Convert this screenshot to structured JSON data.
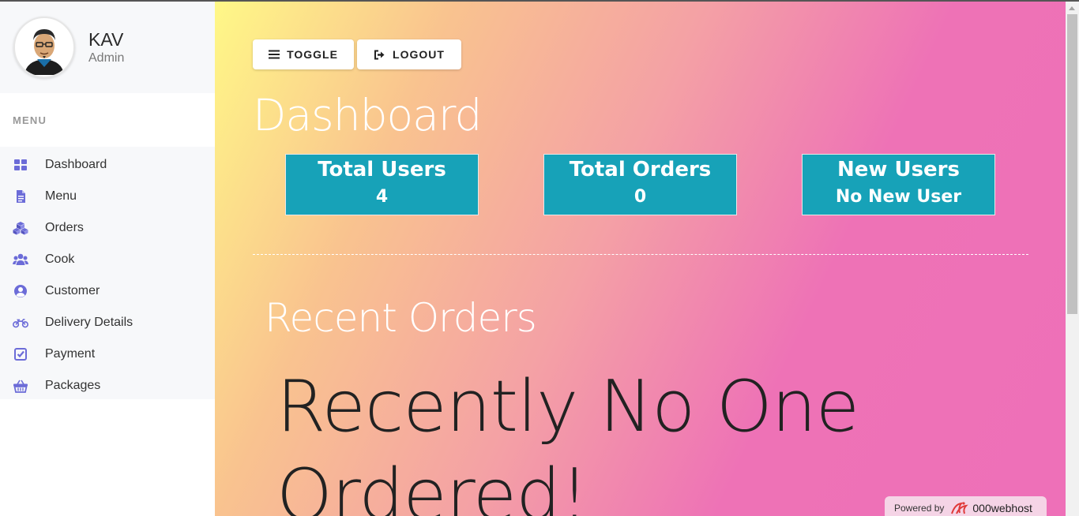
{
  "user": {
    "name": "KAV",
    "role": "Admin"
  },
  "menu": {
    "heading": "MENU",
    "items": [
      {
        "label": "Dashboard",
        "icon": "dashboard-icon"
      },
      {
        "label": "Menu",
        "icon": "document-icon"
      },
      {
        "label": "Orders",
        "icon": "cubes-icon"
      },
      {
        "label": "Cook",
        "icon": "users-icon"
      },
      {
        "label": "Customer",
        "icon": "user-circle-icon"
      },
      {
        "label": "Delivery Details",
        "icon": "motorcycle-icon"
      },
      {
        "label": "Payment",
        "icon": "check-square-icon"
      },
      {
        "label": "Packages",
        "icon": "basket-icon"
      }
    ]
  },
  "toolbar": {
    "toggle_label": "TOGGLE",
    "logout_label": "LOGOUT"
  },
  "main": {
    "title": "Dashboard",
    "cards": [
      {
        "title": "Total Users",
        "value": "4"
      },
      {
        "title": "Total Orders",
        "value": "0"
      },
      {
        "title": "New Users",
        "value": "No New User"
      }
    ],
    "recent_title": "Recent Orders",
    "empty_message": "Recently No One Ordered!"
  },
  "footer": {
    "powered_by": "Powered by",
    "brand": "000webhost"
  },
  "colors": {
    "accent": "#6c6cd8",
    "card": "#17a2b8",
    "sidebar_bg": "#f7f8fa"
  }
}
